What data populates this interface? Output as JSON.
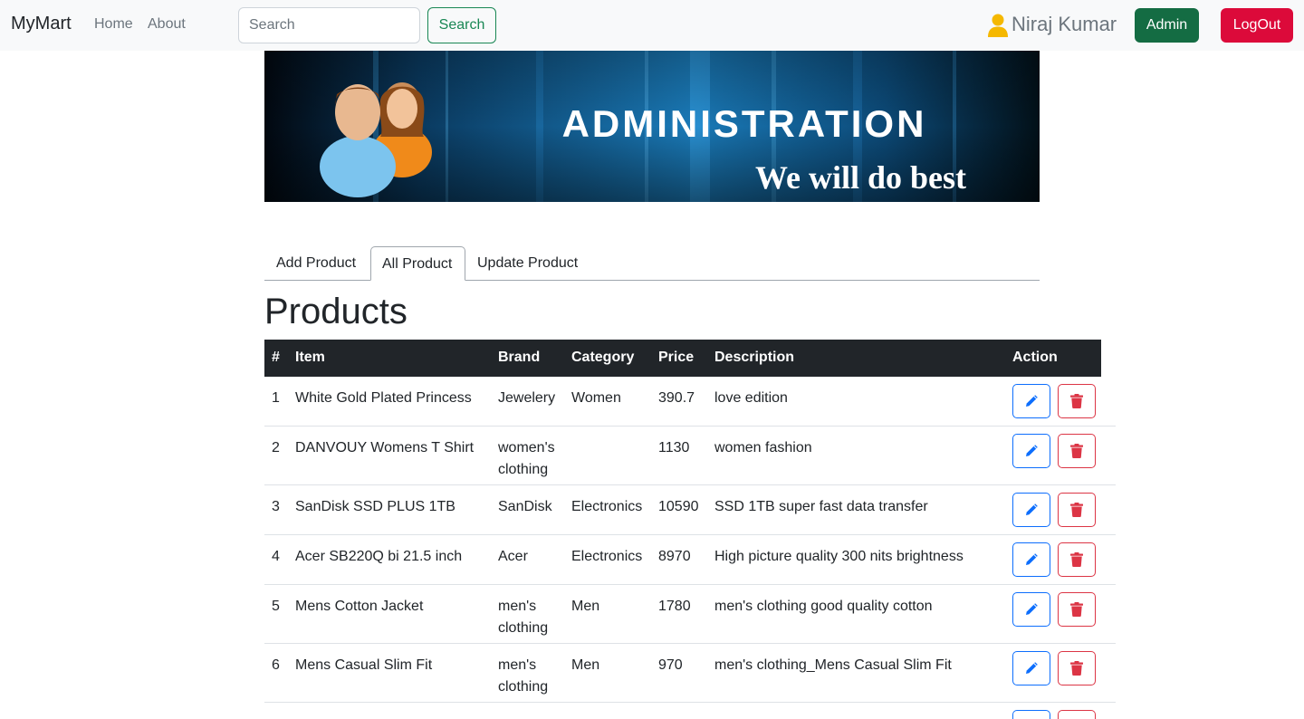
{
  "navbar": {
    "brand": "MyMart",
    "links": [
      "Home",
      "About"
    ],
    "search_placeholder": "Search",
    "search_button": "Search",
    "user_name": "Niraj Kumar",
    "admin_button": "Admin",
    "logout_button": "LogOut",
    "icons": {
      "user": "user-icon"
    }
  },
  "banner": {
    "title": "ADMINISTRATION",
    "tagline": "We will do best"
  },
  "tabs": [
    {
      "label": "Add Product",
      "active": false
    },
    {
      "label": "All Product",
      "active": true
    },
    {
      "label": "Update Product",
      "active": false
    }
  ],
  "page_title": "Products",
  "table": {
    "headers": [
      "#",
      "Item",
      "Brand",
      "Category",
      "Price",
      "Description",
      "Action"
    ],
    "rows": [
      {
        "num": "1",
        "item": "White Gold Plated Princess",
        "brand": "Jewelery",
        "category": "Women",
        "price": "390.7",
        "description": "love edition"
      },
      {
        "num": "2",
        "item": "DANVOUY Womens T Shirt",
        "brand": "women's clothing",
        "category": "",
        "price": "1130",
        "description": "women fashion"
      },
      {
        "num": "3",
        "item": "SanDisk SSD PLUS 1TB",
        "brand": "SanDisk",
        "category": "Electronics",
        "price": "10590",
        "description": "SSD 1TB super fast data transfer"
      },
      {
        "num": "4",
        "item": "Acer SB220Q bi 21.5 inch",
        "brand": "Acer",
        "category": "Electronics",
        "price": "8970",
        "description": "High picture quality 300 nits brightness"
      },
      {
        "num": "5",
        "item": "Mens Cotton Jacket",
        "brand": "men's clothing",
        "category": "Men",
        "price": "1780",
        "description": "men's clothing good quality cotton"
      },
      {
        "num": "6",
        "item": "Mens Casual Slim Fit",
        "brand": "men's clothing",
        "category": "Men",
        "price": "970",
        "description": "men's clothing_Mens Casual Slim Fit"
      }
    ],
    "action_icons": {
      "edit": "pencil-icon",
      "delete": "trash-icon"
    }
  },
  "colors": {
    "navbar_bg": "#f8f9fa",
    "success": "#198754",
    "admin": "#146c43",
    "danger": "#dc0a3a",
    "primary": "#0d6efd",
    "dark": "#212529",
    "user_icon": "#f5b800"
  }
}
